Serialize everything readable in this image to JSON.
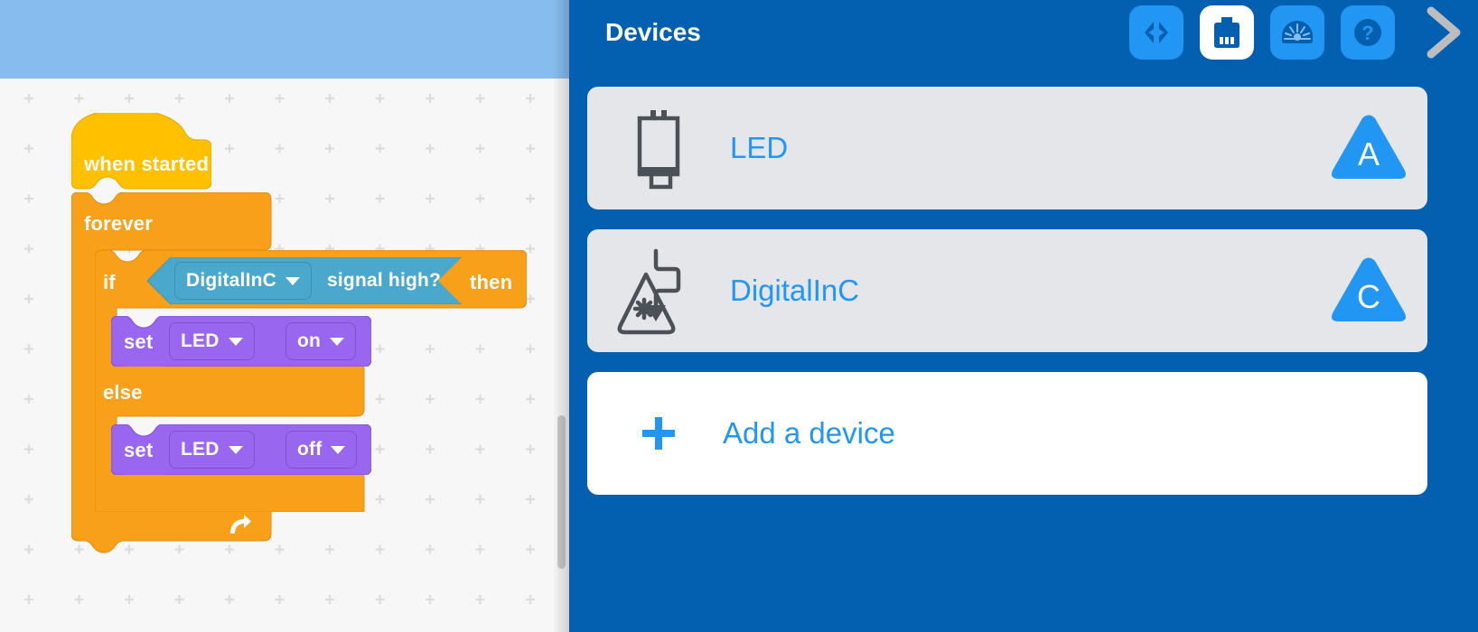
{
  "workspace": {
    "name": "block-programming-canvas",
    "blocks": {
      "when_started": {
        "label": "when started",
        "color": "#ffc000"
      },
      "forever": {
        "label": "forever",
        "color": "#f9a01b"
      },
      "if_block": {
        "if_label": "if",
        "then_label": "then",
        "else_label": "else",
        "color": "#f9a01b"
      },
      "condition": {
        "device": "DigitalInC",
        "predicate": "signal high?",
        "color": "#4aa8cc"
      },
      "set_on": {
        "verb": "set",
        "device": "LED",
        "state": "on",
        "color": "#9966f0"
      },
      "set_off": {
        "verb": "set",
        "device": "LED",
        "state": "off",
        "color": "#9966f0"
      }
    },
    "icons": {
      "loop_arrow": "loop-arrow-icon"
    }
  },
  "panel": {
    "title": "Devices",
    "accent": "#0360b0",
    "header_buttons": [
      {
        "name": "code-view-button",
        "icon": "code-brackets-icon",
        "active": false
      },
      {
        "name": "devices-button",
        "icon": "device-port-icon",
        "active": true
      },
      {
        "name": "dashboard-button",
        "icon": "gauge-icon",
        "active": false
      },
      {
        "name": "help-button",
        "icon": "question-mark-icon",
        "active": false
      }
    ],
    "collapse_icon": "chevron-right-icon",
    "devices": [
      {
        "name": "LED",
        "port": "A",
        "icon": "led-device-icon",
        "port_color": "#2196f3"
      },
      {
        "name": "DigitalInC",
        "port": "C",
        "icon": "digital-in-device-icon",
        "port_color": "#2196f3"
      }
    ],
    "add_device": {
      "label": "Add a device",
      "icon": "plus-icon",
      "color": "#2196f3"
    }
  }
}
